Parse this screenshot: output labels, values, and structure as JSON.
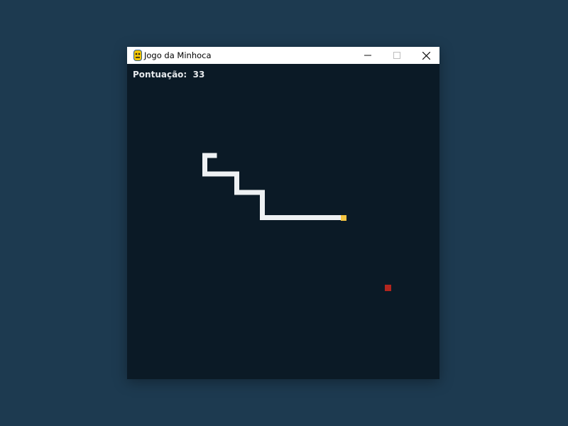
{
  "window": {
    "title": "Jogo da Minhoca",
    "app_icon": "python-icon",
    "controls": {
      "minimize": "minimize-icon",
      "maximize": "maximize-icon",
      "close": "close-icon"
    }
  },
  "game": {
    "score_label": "Pontuação:",
    "score_value": "33",
    "colors": {
      "background": "#0b1a26",
      "snake_body": "#eef1f3",
      "snake_head": "#f5c542",
      "food": "#b3261e",
      "desktop": "#1d3a50"
    }
  }
}
